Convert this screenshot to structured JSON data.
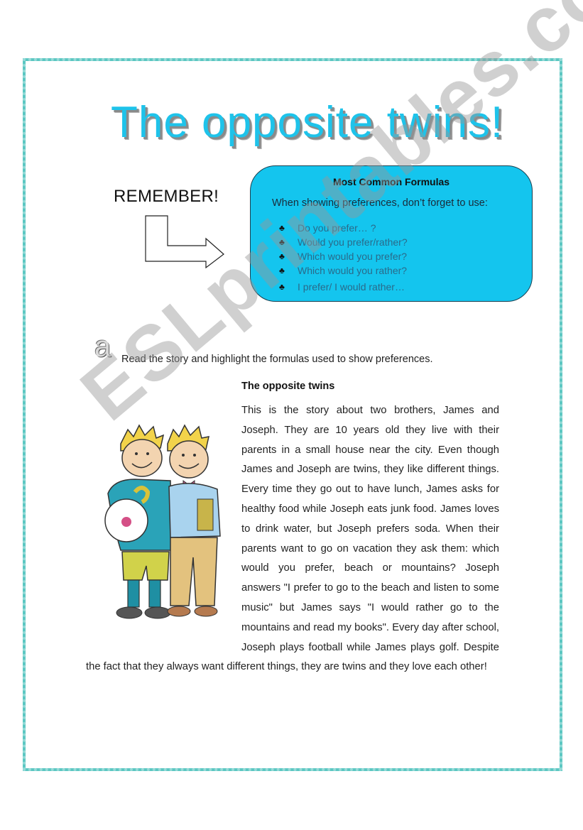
{
  "title": "The opposite twins!",
  "remember": {
    "label": "REMEMBER!",
    "arrow_icon": "bent-arrow-right-icon"
  },
  "formulas_box": {
    "heading": "Most Common Formulas",
    "intro": "When showing preferences, don’t forget to use:",
    "bullet_icon": "club-icon",
    "items": [
      "Do you prefer… ?",
      "Would you prefer/rather?",
      "Which would you prefer?",
      "Which would you rather?",
      "I prefer/ I would rather…"
    ],
    "colors": {
      "fill": "#14c5ee",
      "border": "#1b4050",
      "item_text": "#2a6a8a"
    }
  },
  "exercise": {
    "letter": "a",
    "instruction": "Read the story and highlight the formulas used to show preferences."
  },
  "story": {
    "title": "The opposite twins",
    "text": "This is the story about two brothers, James and Joseph. They are 10 years old they live with their parents in a small house near the city. Even though James and Joseph are twins, they like different things. Every time they go out to have lunch, James asks for healthy food while Joseph eats junk food. James loves to drink water, but Joseph prefers soda. When their parents want to go on vacation they ask them: which would you prefer, beach or mountains? Joseph answers \"I prefer to go to the beach and listen to some music\" but James says \"I would rather go to the mountains and read my books\". Every day after school, Joseph plays football while James plays golf. Despite the fact that they always want different things, they are twins and they love each other!",
    "image": "twin-boys-illustration"
  },
  "watermark": "ESLprintables.com",
  "colors": {
    "title": "#1ec3ea",
    "border": "#5cc7c2"
  }
}
